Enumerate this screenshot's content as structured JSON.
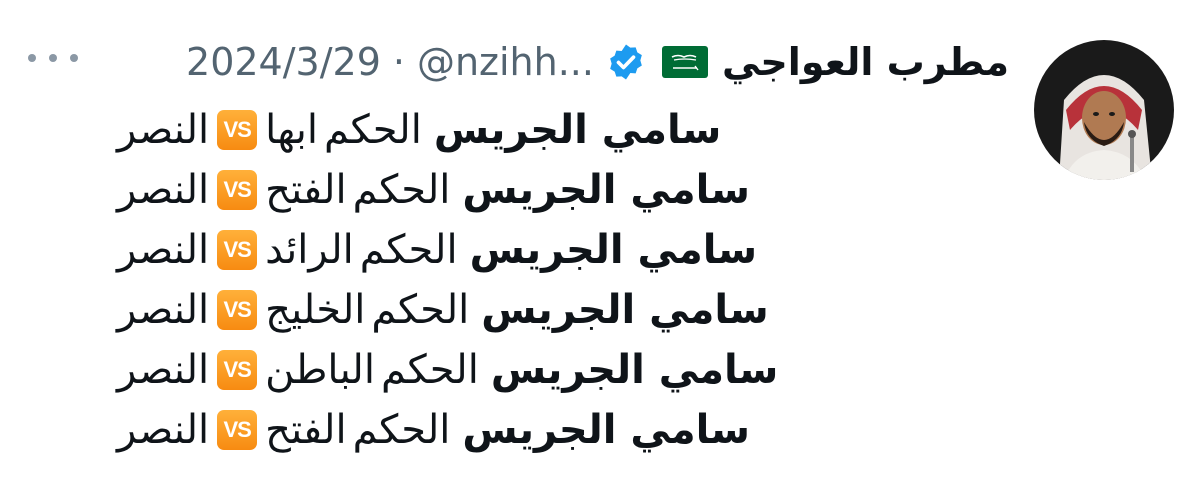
{
  "tweet": {
    "author": {
      "display_name": "مطرب العواجي",
      "handle": "@nzihh...",
      "verified_icon": "verified-badge-icon",
      "flag_icon": "saudi-flag-icon"
    },
    "separator": "·",
    "date": "2024/3/29",
    "more_icon": "more-options-icon",
    "lines": [
      {
        "team_a": "النصر",
        "vs": "VS",
        "team_b": "ابها",
        "role": "الحكم",
        "referee": "سامي الجريس"
      },
      {
        "team_a": "النصر",
        "vs": "VS",
        "team_b": "الفتح",
        "role": "الحكم",
        "referee": "سامي الجريس"
      },
      {
        "team_a": "النصر",
        "vs": "VS",
        "team_b": "الرائد",
        "role": "الحكم",
        "referee": "سامي الجريس"
      },
      {
        "team_a": "النصر",
        "vs": "VS",
        "team_b": "الخليج",
        "role": "الحكم",
        "referee": "سامي الجريس"
      },
      {
        "team_a": "النصر",
        "vs": "VS",
        "team_b": "الباطن",
        "role": "الحكم",
        "referee": "سامي الجريس"
      },
      {
        "team_a": "النصر",
        "vs": "VS",
        "team_b": "الفتح",
        "role": "الحكم",
        "referee": "سامي الجريس"
      }
    ]
  },
  "colors": {
    "text_primary": "#0f1419",
    "text_secondary": "#536471",
    "verified_blue": "#1d9bf0",
    "vs_orange": "#f78b12",
    "flag_green": "#006c35"
  }
}
